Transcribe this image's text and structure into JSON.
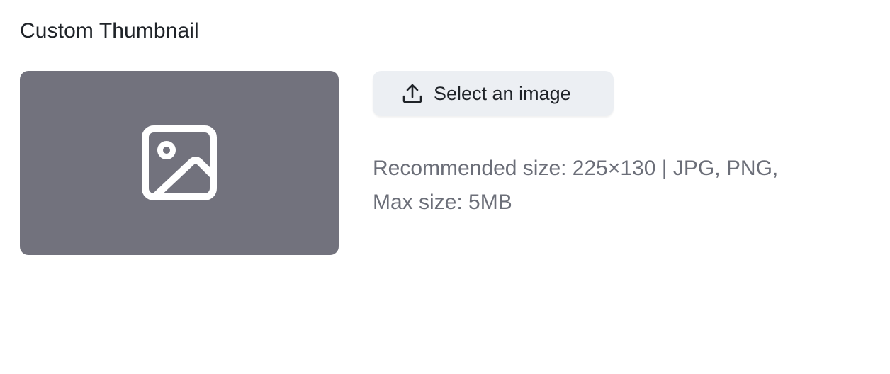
{
  "section": {
    "title": "Custom Thumbnail"
  },
  "thumbnail": {
    "icon": "image-placeholder-icon",
    "background_color": "#72727d"
  },
  "upload": {
    "button_label": "Select an image",
    "icon": "upload-icon",
    "button_color": "#eceff3"
  },
  "hint": {
    "line1": "Recommended size: 225×130 | JPG, PNG,",
    "line2": "Max size: 5MB"
  }
}
